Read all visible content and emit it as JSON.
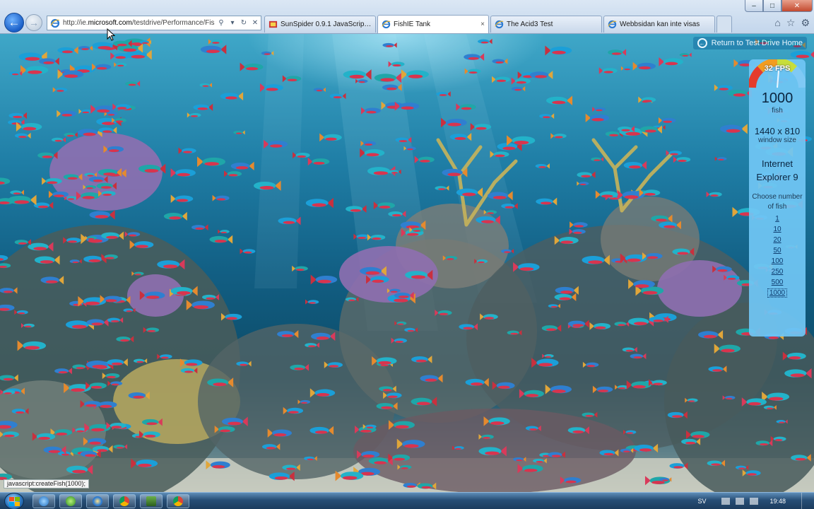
{
  "browser": {
    "url_prefix": "http://ie.",
    "url_domain": "microsoft.com",
    "url_rest": "/testdrive/Performance/Fis",
    "tabs": [
      {
        "label": "SunSpider 0.9.1 JavaScript Ben...",
        "active": false,
        "icon": "ie-favicon"
      },
      {
        "label": "FishIE Tank",
        "active": true,
        "icon": "ie-favicon"
      },
      {
        "label": "The Acid3 Test",
        "active": false,
        "icon": "ie-favicon"
      },
      {
        "label": "Webbsidan kan inte visas",
        "active": false,
        "icon": "ie-favicon"
      }
    ],
    "tab_close": "×",
    "window_controls": {
      "minimize": "–",
      "maximize": "□",
      "close": "✕"
    },
    "status_text": "javascript:createFish(1000);"
  },
  "page": {
    "return_link": "Return to Test Drive Home"
  },
  "panel": {
    "fps": "32 FPS",
    "fish_count": "1000",
    "fish_label": "fish",
    "resolution": "1440 x 810",
    "resolution_label": "window size",
    "browser_line1": "Internet",
    "browser_line2": "Explorer 9",
    "choose_label_line1": "Choose number",
    "choose_label_line2": "of fish",
    "options": [
      "1",
      "10",
      "20",
      "50",
      "100",
      "250",
      "500",
      "1000"
    ],
    "selected": "1000"
  },
  "taskbar": {
    "pinned": [
      "ie-icon",
      "chrome-icon",
      "media-icon",
      "ie-icon",
      "explorer-icon",
      "chrome-icon"
    ],
    "language": "SV",
    "clock": "19:48"
  },
  "colors": {
    "panel_bg": "#70c6f4",
    "address_accent": "#1a5fc8",
    "water_top": "#3fa7c8",
    "water_deep": "#0c4a66"
  }
}
